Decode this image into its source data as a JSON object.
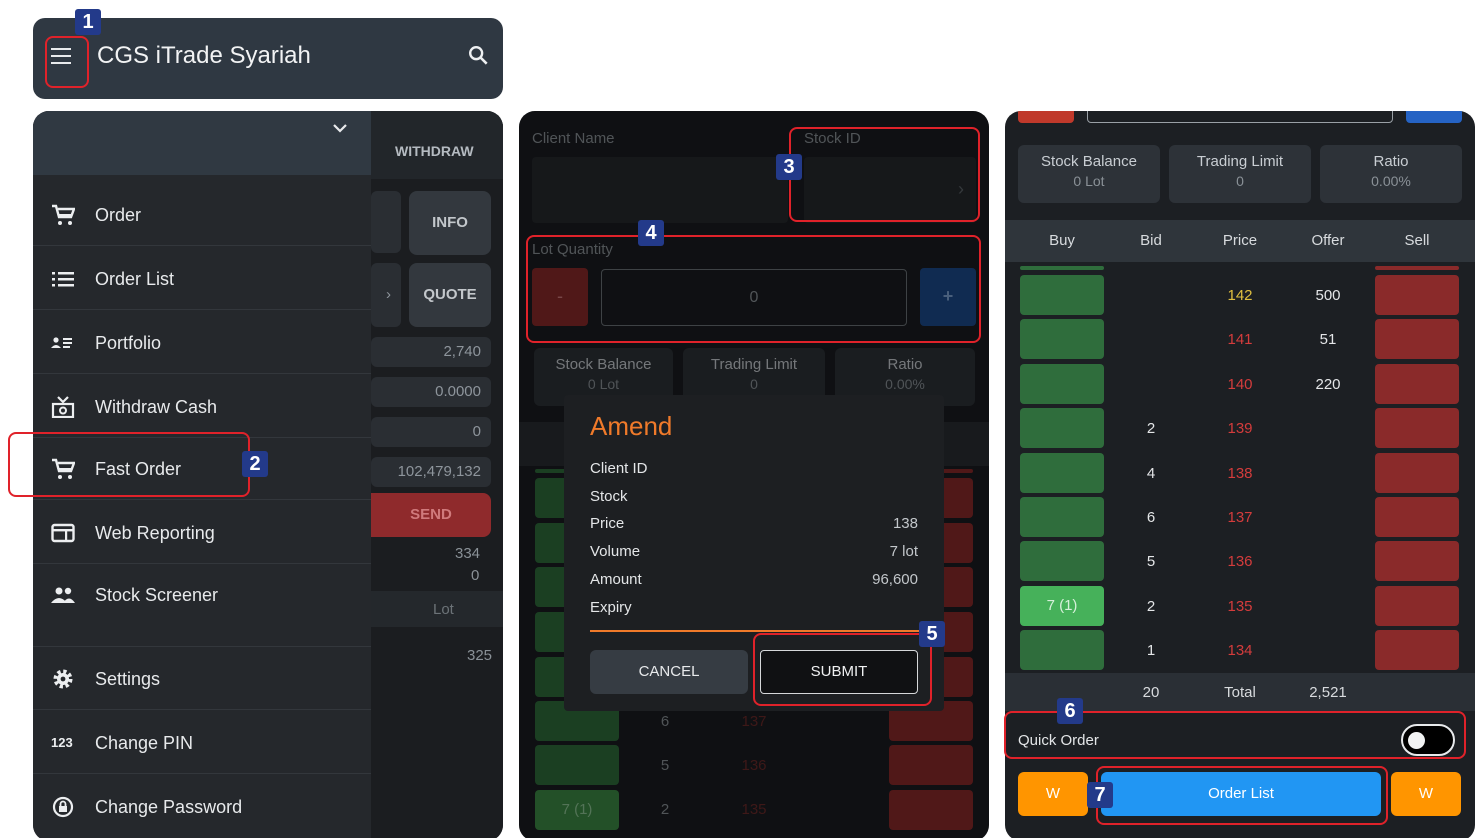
{
  "topbar": {
    "title": "CGS iTrade Syariah",
    "menu_icon": "hamburger-icon",
    "search_icon": "search-icon"
  },
  "callouts": [
    "1",
    "2",
    "3",
    "4",
    "5",
    "6",
    "7"
  ],
  "drawer": {
    "items": [
      {
        "label": "Order",
        "icon": "cart-icon"
      },
      {
        "label": "Order List",
        "icon": "list-icon"
      },
      {
        "label": "Portfolio",
        "icon": "portfolio-icon"
      },
      {
        "label": "Withdraw Cash",
        "icon": "cash-icon"
      },
      {
        "label": "Fast Order",
        "icon": "cart-icon"
      },
      {
        "label": "Web Reporting",
        "icon": "report-icon"
      },
      {
        "label": "Stock Screener",
        "icon": "people-icon"
      },
      {
        "label": "Settings",
        "icon": "gear-icon"
      },
      {
        "label": "Change PIN",
        "icon": "pin-icon"
      },
      {
        "label": "Change Password",
        "icon": "lock-icon"
      }
    ]
  },
  "behind_drawer": {
    "withdraw": "WITHDRAW",
    "info": "INFO",
    "quote": "QUOTE",
    "values": [
      "2,740",
      "0.0000",
      "0",
      "102,479,132"
    ],
    "send": "SEND",
    "v334": "334",
    "v0": "0",
    "lot": "Lot",
    "v325": "325"
  },
  "order_form": {
    "client_name_label": "Client Name",
    "stock_id_label": "Stock ID",
    "lot_qty_label": "Lot Quantity",
    "minus": "-",
    "plus": "+",
    "qty_value": "0",
    "stock_balance": {
      "label": "Stock Balance",
      "value": "0 Lot"
    },
    "trading_limit": {
      "label": "Trading Limit",
      "value": "0"
    },
    "ratio": {
      "label": "Ratio",
      "value": "0.00%"
    },
    "bg_rows": [
      {
        "bid": "6",
        "price": "137"
      },
      {
        "bid": "5",
        "price": "136"
      },
      {
        "buy": "7 (1)",
        "bid": "2",
        "price": "135"
      }
    ]
  },
  "amend_dialog": {
    "title": "Amend",
    "rows": [
      {
        "label": "Client ID",
        "value": ""
      },
      {
        "label": "Stock",
        "value": ""
      },
      {
        "label": "Price",
        "value": "138"
      },
      {
        "label": "Volume",
        "value": "7 lot"
      },
      {
        "label": "Amount",
        "value": "96,600"
      },
      {
        "label": "Expiry",
        "value": ""
      }
    ],
    "cancel": "CANCEL",
    "submit": "SUBMIT"
  },
  "orderbook": {
    "stock_balance": {
      "label": "Stock Balance",
      "value": "0 Lot"
    },
    "trading_limit": {
      "label": "Trading Limit",
      "value": "0"
    },
    "ratio": {
      "label": "Ratio",
      "value": "0.00%"
    },
    "headers": [
      "Buy",
      "Bid",
      "Price",
      "Offer",
      "Sell"
    ],
    "rows": [
      {
        "buy": "",
        "bid": "",
        "price": "142",
        "offer": "500",
        "price_color": "#e0c040"
      },
      {
        "buy": "",
        "bid": "",
        "price": "141",
        "offer": "51",
        "price_color": "#d43c3c"
      },
      {
        "buy": "",
        "bid": "",
        "price": "140",
        "offer": "220",
        "price_color": "#d43c3c"
      },
      {
        "buy": "",
        "bid": "2",
        "price": "139",
        "offer": "",
        "price_color": "#d43c3c"
      },
      {
        "buy": "",
        "bid": "4",
        "price": "138",
        "offer": "",
        "price_color": "#d43c3c"
      },
      {
        "buy": "",
        "bid": "6",
        "price": "137",
        "offer": "",
        "price_color": "#d43c3c"
      },
      {
        "buy": "",
        "bid": "5",
        "price": "136",
        "offer": "",
        "price_color": "#d43c3c"
      },
      {
        "buy": "7 (1)",
        "bid": "2",
        "price": "135",
        "offer": "",
        "price_color": "#d43c3c"
      },
      {
        "buy": "",
        "bid": "1",
        "price": "134",
        "offer": "",
        "price_color": "#d43c3c"
      }
    ],
    "total_bid": "20",
    "total_label": "Total",
    "total_offer": "2,521",
    "quick_order_label": "Quick Order",
    "w_left": "W",
    "order_list": "Order List",
    "w_right": "W"
  },
  "colors": {
    "accent_orange": "#ff9500",
    "accent_blue": "#2196f3",
    "highlight_red": "#e0222a",
    "callout_navy": "#233a8a"
  }
}
